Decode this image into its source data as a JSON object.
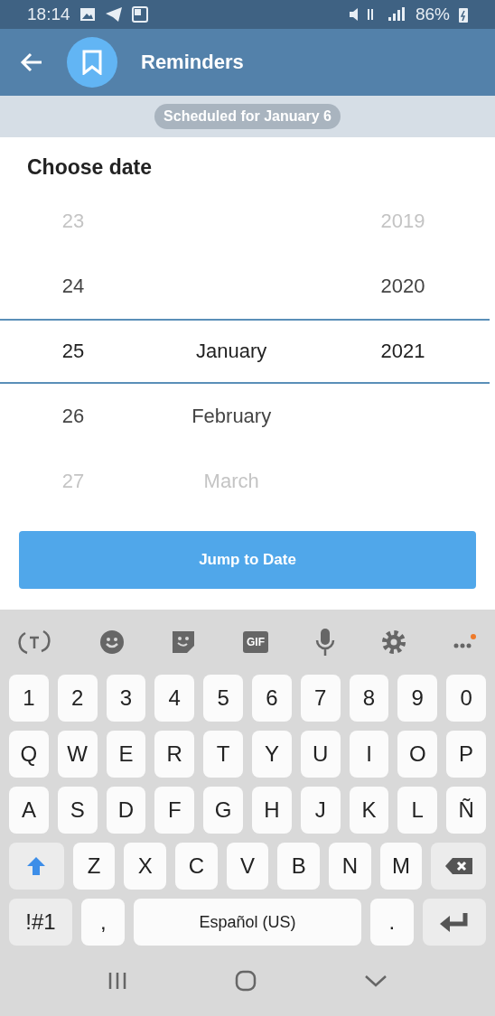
{
  "status_bar": {
    "time": "18:14",
    "battery": "86%"
  },
  "header": {
    "title": "Reminders"
  },
  "chat": {
    "scheduled_label": "Scheduled for January 6"
  },
  "date_picker": {
    "title": "Choose date",
    "rows": [
      {
        "day": "23",
        "year": "2019",
        "selected": false
      },
      {
        "day": "24",
        "year": "2020",
        "selected": false
      },
      {
        "day": "25",
        "month": "January",
        "year": "2021",
        "selected": true
      },
      {
        "day": "26",
        "month": "February",
        "selected": false
      },
      {
        "day": "27",
        "month": "March",
        "selected": false
      }
    ],
    "button": "Jump to Date"
  },
  "keyboard": {
    "gif_label": "GIF",
    "digit_keys": [
      [
        {
          "kind": "char",
          "label": "1"
        },
        {
          "kind": "char",
          "label": "2"
        },
        {
          "kind": "char",
          "label": "3"
        },
        {
          "kind": "char",
          "label": "4"
        },
        {
          "kind": "char",
          "label": "5"
        },
        {
          "kind": "char",
          "label": "6"
        },
        {
          "kind": "char",
          "label": "7"
        },
        {
          "kind": "char",
          "label": "8"
        },
        {
          "kind": "char",
          "label": "9"
        },
        {
          "kind": "char",
          "label": "0"
        }
      ],
      [
        {
          "kind": "char",
          "label": "Q"
        },
        {
          "kind": "char",
          "label": "W"
        },
        {
          "kind": "char",
          "label": "E"
        },
        {
          "kind": "char",
          "label": "R"
        },
        {
          "kind": "char",
          "label": "T"
        },
        {
          "kind": "char",
          "label": "Y"
        },
        {
          "kind": "char",
          "label": "U"
        },
        {
          "kind": "char",
          "label": "I"
        },
        {
          "kind": "char",
          "label": "O"
        },
        {
          "kind": "char",
          "label": "P"
        }
      ],
      [
        {
          "kind": "char",
          "label": "A"
        },
        {
          "kind": "char",
          "label": "S"
        },
        {
          "kind": "char",
          "label": "D"
        },
        {
          "kind": "char",
          "label": "F"
        },
        {
          "kind": "char",
          "label": "G"
        },
        {
          "kind": "char",
          "label": "H"
        },
        {
          "kind": "char",
          "label": "J"
        },
        {
          "kind": "char",
          "label": "K"
        },
        {
          "kind": "char",
          "label": "L"
        },
        {
          "kind": "char",
          "label": "Ñ"
        }
      ],
      [
        {
          "kind": "shift"
        },
        {
          "kind": "char",
          "label": "Z"
        },
        {
          "kind": "char",
          "label": "X"
        },
        {
          "kind": "char",
          "label": "C"
        },
        {
          "kind": "char",
          "label": "V"
        },
        {
          "kind": "char",
          "label": "B"
        },
        {
          "kind": "char",
          "label": "N"
        },
        {
          "kind": "char",
          "label": "M"
        },
        {
          "kind": "backspace"
        }
      ],
      [
        {
          "kind": "symbols",
          "label": "!#1"
        },
        {
          "kind": "char",
          "label": ","
        },
        {
          "kind": "space",
          "label": "Español (US)"
        },
        {
          "kind": "char",
          "label": "."
        },
        {
          "kind": "enter"
        }
      ]
    ]
  }
}
